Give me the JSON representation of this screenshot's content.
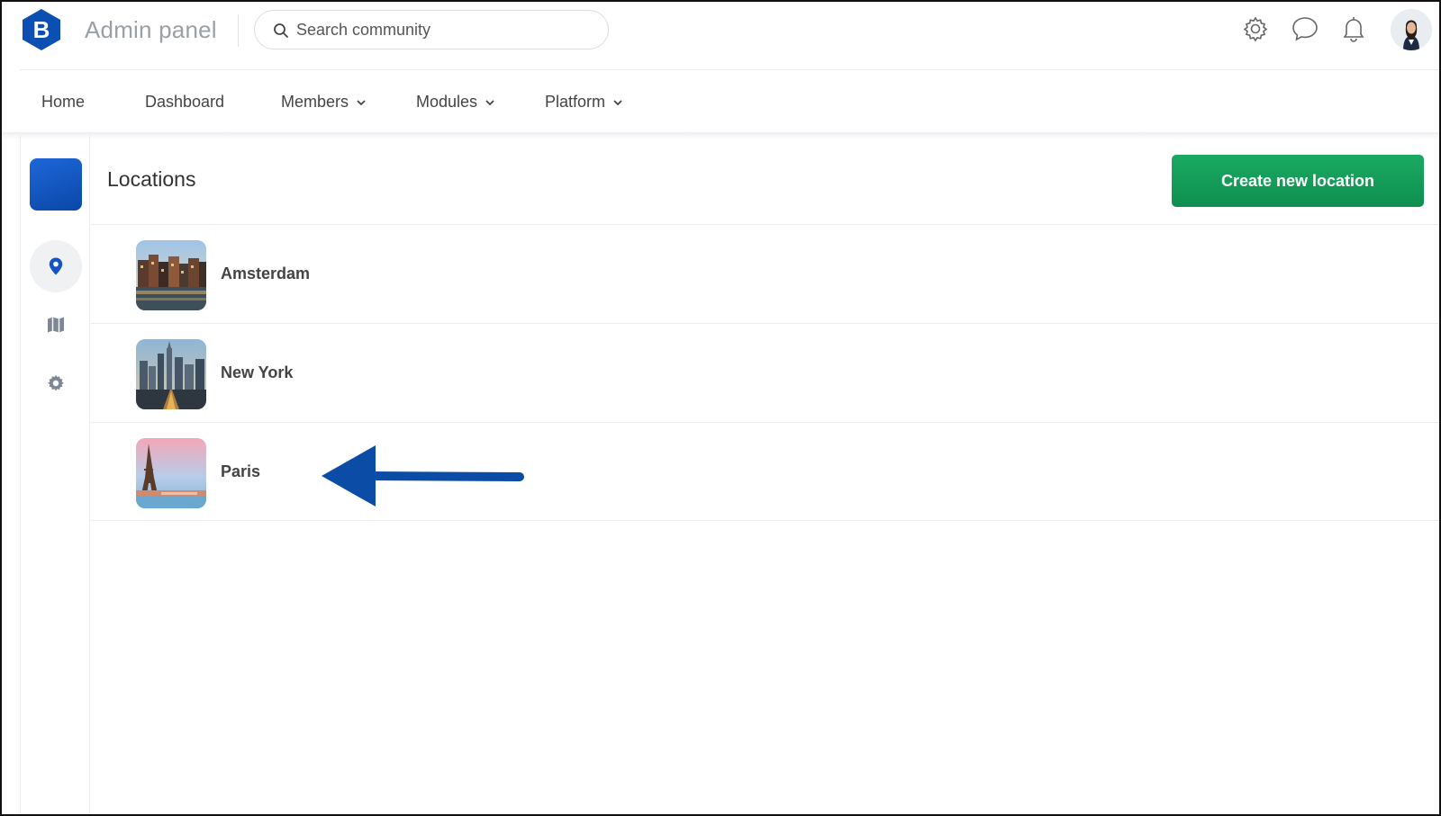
{
  "app": {
    "title": "Admin panel",
    "logo_letter": "B"
  },
  "search": {
    "placeholder": "Search community",
    "value": ""
  },
  "header_icons": [
    "gear-icon",
    "chat-bubble-icon",
    "bell-icon"
  ],
  "nav": {
    "items": [
      {
        "label": "Home",
        "dropdown": false
      },
      {
        "label": "Dashboard",
        "dropdown": false
      },
      {
        "label": "Members",
        "dropdown": true
      },
      {
        "label": "Modules",
        "dropdown": true
      },
      {
        "label": "Platform",
        "dropdown": true
      }
    ]
  },
  "sidebar": {
    "items": [
      {
        "icon": "map-pin-icon",
        "active": true
      },
      {
        "icon": "map-icon",
        "active": false
      },
      {
        "icon": "cog-icon",
        "active": false
      }
    ]
  },
  "page": {
    "title": "Locations",
    "create_button_label": "Create new location"
  },
  "locations": [
    {
      "name": "Amsterdam"
    },
    {
      "name": "New York"
    },
    {
      "name": "Paris"
    }
  ],
  "colors": {
    "brand_blue": "#0b4fb3",
    "primary_green": "#14a05a",
    "annotation_arrow": "#0b4da6"
  }
}
